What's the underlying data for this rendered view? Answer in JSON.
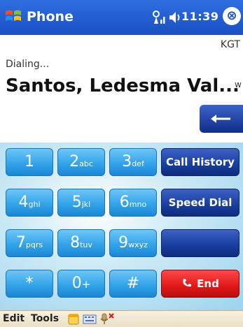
{
  "titlebar": {
    "title": "Phone",
    "time": "11:39",
    "close_glyph": "⊗"
  },
  "call": {
    "carrier": "KGT",
    "status": "Dialing...",
    "contact": "Santos, Ledesma Val...",
    "number_type": "w"
  },
  "keypad": {
    "keys": [
      {
        "digit": "1",
        "letters": ""
      },
      {
        "digit": "2",
        "letters": "abc"
      },
      {
        "digit": "3",
        "letters": "def"
      },
      {
        "digit": "4",
        "letters": "ghi"
      },
      {
        "digit": "5",
        "letters": "jkl"
      },
      {
        "digit": "6",
        "letters": "mno"
      },
      {
        "digit": "7",
        "letters": "pqrs"
      },
      {
        "digit": "8",
        "letters": "tuv"
      },
      {
        "digit": "9",
        "letters": "wxyz"
      },
      {
        "digit": "*",
        "letters": ""
      },
      {
        "digit": "0",
        "letters": "+"
      },
      {
        "digit": "#",
        "letters": ""
      }
    ],
    "call_history_label": "Call History",
    "speed_dial_label": "Speed Dial",
    "end_label": "End"
  },
  "menubar": {
    "edit_label": "Edit",
    "tools_label": "Tools"
  },
  "colors": {
    "title_bar": "#1a4fc2",
    "digit_key": "#33a4ea",
    "function_key": "#173d9e",
    "end_key": "#e01818"
  }
}
